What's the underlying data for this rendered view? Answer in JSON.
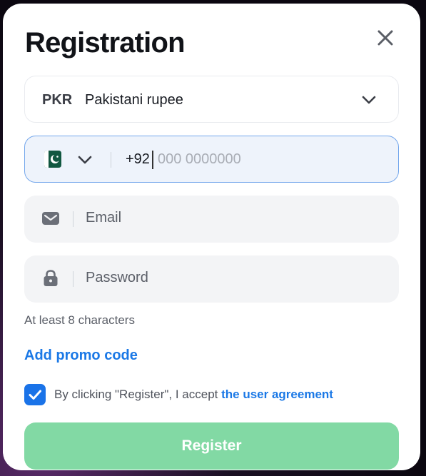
{
  "modal": {
    "title": "Registration"
  },
  "currency": {
    "code": "PKR",
    "name": "Pakistani rupee"
  },
  "phone": {
    "prefix": "+92",
    "placeholder": "000 0000000",
    "country_icon": "pakistan-flag-icon"
  },
  "email": {
    "placeholder": "Email",
    "icon": "envelope-icon"
  },
  "password": {
    "placeholder": "Password",
    "icon": "lock-icon",
    "hint": "At least 8 characters"
  },
  "promo": {
    "label": "Add promo code"
  },
  "agreement": {
    "checked": true,
    "text": "By clicking \"Register\", I accept ",
    "link": "the user agreement"
  },
  "register": {
    "label": "Register"
  },
  "colors": {
    "accent_blue": "#1a78e6",
    "register_green": "#82d9a4",
    "field_bg": "#f3f4f6",
    "phone_border": "#74a7ec"
  }
}
